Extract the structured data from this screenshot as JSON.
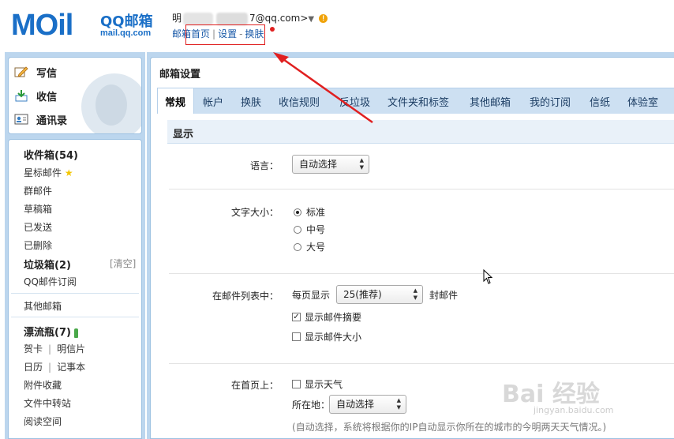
{
  "header": {
    "logo_text": "MOil",
    "logo_brand": "QQ邮箱",
    "logo_url": "mail.qq.com",
    "user_name_prefix": "明",
    "user_email_suffix": "7@qq.com>",
    "account_dropdown": "▼",
    "links": {
      "home": "邮箱首页",
      "settings": "设置",
      "dash": "-",
      "skin": "换肤"
    }
  },
  "sidebar": {
    "actions": [
      {
        "label": "写信",
        "icon": "pencil-icon"
      },
      {
        "label": "收信",
        "icon": "inbox-download-icon"
      },
      {
        "label": "通讯录",
        "icon": "contacts-icon"
      }
    ],
    "folders": [
      {
        "label": "收件箱(54)",
        "bold": true
      },
      {
        "label": "星标邮件",
        "star": "★"
      },
      {
        "label": "群邮件"
      },
      {
        "label": "草稿箱"
      },
      {
        "label": "已发送"
      },
      {
        "label": "已删除"
      },
      {
        "label": "垃圾箱(2)",
        "bold": true
      },
      {
        "label": "QQ邮件订阅"
      }
    ],
    "clear_label": "[清空]",
    "other_mailbox": "其他邮箱",
    "drift_bottle": "漂流瓶(7)",
    "apps": [
      {
        "a": "贺卡",
        "b": "明信片"
      },
      {
        "a": "日历",
        "b": "记事本"
      }
    ],
    "sep": "|",
    "more": [
      "附件收藏",
      "文件中转站",
      "阅读空间"
    ]
  },
  "main": {
    "title": "邮箱设置",
    "tabs": [
      "常规",
      "帐户",
      "换肤",
      "收信规则",
      "反垃圾",
      "文件夹和标签",
      "其他邮箱",
      "我的订阅",
      "信纸",
      "体验室"
    ],
    "active_tab": "常规",
    "section_title": "显示",
    "language": {
      "label": "语言：",
      "value": "自动选择"
    },
    "font_size": {
      "label": "文字大小：",
      "options": [
        "标准",
        "中号",
        "大号"
      ],
      "selected": "标准"
    },
    "mail_list": {
      "label": "在邮件列表中：",
      "per_page_prefix": "每页显示",
      "per_page_value": "25(推荐)",
      "per_page_suffix": "封邮件",
      "show_summary": "显示邮件摘要",
      "show_summary_checked": true,
      "show_size": "显示邮件大小",
      "show_size_checked": false
    },
    "homepage": {
      "label": "在首页上：",
      "show_weather": "显示天气",
      "show_weather_checked": false,
      "location_label": "所在地：",
      "location_value": "自动选择",
      "note": "(自动选择，系统将根据你的IP自动显示你所在的城市的今明两天天气情况。)"
    }
  },
  "watermark": {
    "text": "Bai  经验",
    "url": "jingyan.baidu.com"
  },
  "colors": {
    "brand_blue": "#1a6fc7",
    "annotation_red": "#e02020",
    "tab_bar": "#cde0f2",
    "side_bg": "#bcd6ee"
  }
}
